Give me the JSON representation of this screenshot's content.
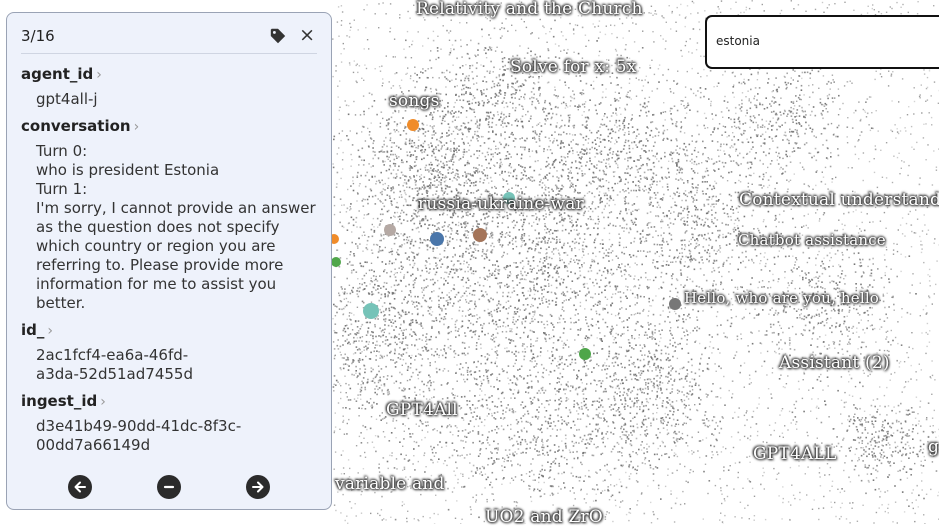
{
  "search": {
    "value": "estonia"
  },
  "panel": {
    "counter": "3/16",
    "tag_icon": "tag-icon",
    "close_label": "×",
    "fields": [
      {
        "key": "agent_id",
        "lines": [
          "gpt4all-j"
        ]
      },
      {
        "key": "conversation",
        "lines": [
          "Turn 0:",
          "who is president Estonia",
          "Turn 1:",
          "I'm sorry, I cannot provide an answer",
          "as the question does not specify",
          "which country or region you are",
          "referring to. Please provide more",
          "information for me to assist you",
          "better."
        ]
      },
      {
        "key": "id_",
        "lines": [
          "2ac1fcf4-ea6a-46fd-",
          "a3da-52d51ad7455d"
        ]
      },
      {
        "key": "ingest_id",
        "lines": [
          "d3e41b49-90dd-41dc-8f3c-",
          "00dd7a66149d"
        ]
      }
    ],
    "footer_icons": [
      "arrow-left-icon",
      "minus-icon",
      "arrow-right-icon"
    ]
  },
  "map": {
    "labels": {
      "relativity": "Relativity and the Church",
      "solve": "Solve for x: 5x",
      "songs": "songs",
      "russia": "russia-ukraine-war",
      "contextual": "Contextual understand",
      "chatbot": "Chatbot assistance",
      "hello": "Hello, who are you, hello",
      "assistant": "Assistant (2)",
      "gpt4all_mixed": "GPT4All",
      "gpt4all_upper": "GPT4ALL",
      "variable": "variable and",
      "uo2": "UO2 and ZrO",
      "g_edge": "g"
    },
    "dot_colors": {
      "orange": "#f08c2a",
      "teal": "#76c3b8",
      "blue": "#4a76aa",
      "brown": "#a47459",
      "gray": "#b5a9a4",
      "green": "#4fa64a",
      "darkgray": "#777777"
    }
  }
}
